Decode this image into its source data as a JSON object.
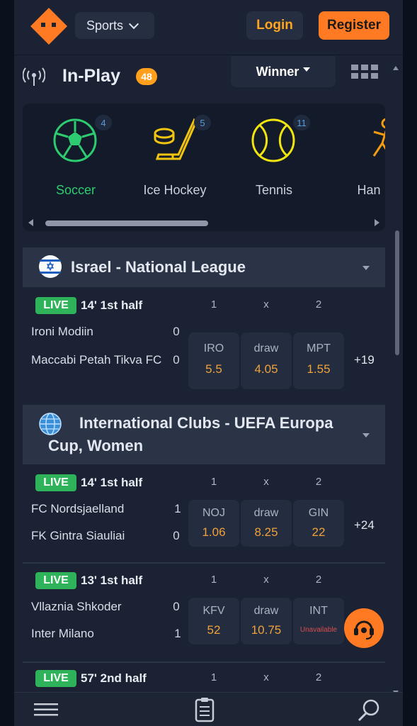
{
  "header": {
    "sports_label": "Sports",
    "login_label": "Login",
    "register_label": "Register"
  },
  "inplay": {
    "title": "In-Play",
    "count": "48",
    "market_selector": "Winner"
  },
  "sports": [
    {
      "label": "Soccer",
      "count": "4",
      "icon": "soccer-ball-icon",
      "color": "#2ecc71"
    },
    {
      "label": "Ice Hockey",
      "count": "5",
      "icon": "ice-hockey-icon",
      "color": "#f1c40f"
    },
    {
      "label": "Tennis",
      "count": "11",
      "icon": "tennis-ball-icon",
      "color": "#f1e40f"
    },
    {
      "label": "Han",
      "count": "",
      "icon": "handball-icon",
      "color": "#f39c12"
    }
  ],
  "leagues": [
    {
      "name": "Israel - National League",
      "flag": "israel-flag-icon",
      "matches": [
        {
          "live": "LIVE",
          "time": "14' 1st half",
          "col1": "1",
          "colx": "x",
          "col2": "2",
          "home": "Ironi Modiin",
          "home_score": "0",
          "away": "Maccabi Petah Tikva FC",
          "away_score": "0",
          "odds": [
            {
              "label": "IRO",
              "value": "5.5"
            },
            {
              "label": "draw",
              "value": "4.05"
            },
            {
              "label": "MPT",
              "value": "1.55"
            }
          ],
          "more": "+19"
        }
      ]
    },
    {
      "name": "International Clubs - UEFA Europa Cup, Women",
      "flag": "globe-icon",
      "matches": [
        {
          "live": "LIVE",
          "time": "14' 1st half",
          "col1": "1",
          "colx": "x",
          "col2": "2",
          "home": "FC Nordsjaelland",
          "home_score": "1",
          "away": "FK Gintra Siauliai",
          "away_score": "0",
          "odds": [
            {
              "label": "NOJ",
              "value": "1.06"
            },
            {
              "label": "draw",
              "value": "8.25"
            },
            {
              "label": "GIN",
              "value": "22"
            }
          ],
          "more": "+24"
        },
        {
          "live": "LIVE",
          "time": "13' 1st half",
          "col1": "1",
          "colx": "x",
          "col2": "2",
          "home": "Vllaznia Shkoder",
          "home_score": "0",
          "away": "Inter Milano",
          "away_score": "1",
          "odds": [
            {
              "label": "KFV",
              "value": "52"
            },
            {
              "label": "draw",
              "value": "10.75"
            },
            {
              "label": "INT",
              "value": "Unavailable"
            }
          ],
          "more": ""
        },
        {
          "live": "LIVE",
          "time": "57' 2nd half",
          "col1": "1",
          "colx": "x",
          "col2": "2"
        }
      ]
    }
  ],
  "colors": {
    "accent_orange": "#ff7a22",
    "live_green": "#2fb35a",
    "odds_value": "#f0a13a",
    "background": "#1a2233"
  }
}
